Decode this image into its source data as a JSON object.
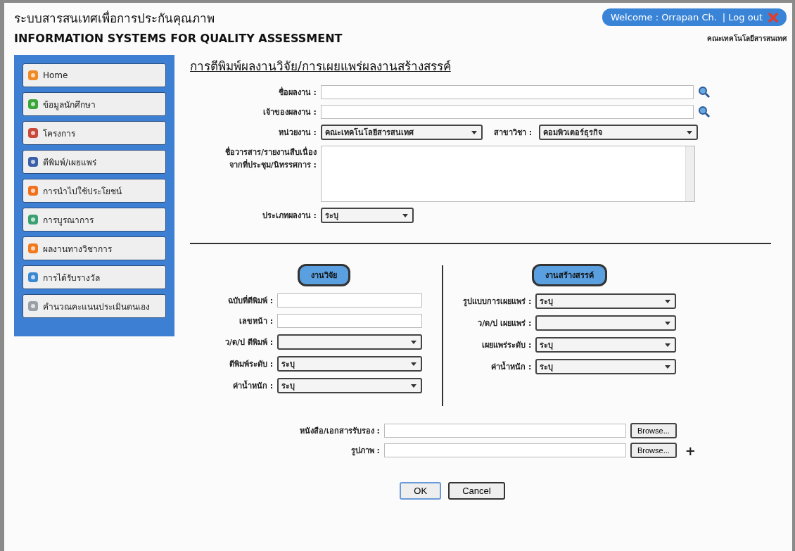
{
  "header": {
    "title_th": "ระบบสารสนเทศเพื่อการประกันคุณภาพ",
    "title_en": "INFORMATION SYSTEMS FOR QUALITY ASSESSMENT",
    "welcome": "Welcome : Orrapan Ch.",
    "logout": "| Log out",
    "faculty": "คณะเทคโนโลยีสารสนเทศ"
  },
  "sidebar": {
    "items": [
      {
        "label": "Home"
      },
      {
        "label": "ข้อมูลนักศึกษา"
      },
      {
        "label": "โครงการ"
      },
      {
        "label": "ตีพิมพ์/เผยแพร่"
      },
      {
        "label": "การนำไปใช้ประโยชน์"
      },
      {
        "label": "การบูรณาการ"
      },
      {
        "label": "ผลงานทางวิชาการ"
      },
      {
        "label": "การได้รับรางวัล"
      },
      {
        "label": "คำนวณคะแนนประเมินตนเอง"
      }
    ]
  },
  "form": {
    "title": "การตีพิมพ์ผลงานวิจัย/การเผยแพร่ผลงานสร้างสรรค์",
    "work_name": {
      "label": "ชื่อผลงาน :"
    },
    "owner": {
      "label": "เจ้าของผลงาน :"
    },
    "unit": {
      "label": "หน่วยงาน :",
      "value": "คณะเทคโนโลยีสารสนเทศ"
    },
    "major": {
      "label": "สาขาวิชา :",
      "value": "คอมพิวเตอร์ธุรกิจ"
    },
    "journal": {
      "label": "ชื่อวารสาร/รายงานสืบเนื่อง จากที่ประชุม/นิทรรศการ :"
    },
    "type": {
      "label": "ประเภทผลงาน :",
      "value": "ระบุ"
    }
  },
  "research": {
    "button": "งานวิจัย",
    "fields": [
      {
        "kind": "text",
        "label": "ฉบับที่ตีพิมพ์ :"
      },
      {
        "kind": "text",
        "label": "เลขหน้า :"
      },
      {
        "kind": "select",
        "label": "ว/ด/ป ตีพิมพ์ :"
      },
      {
        "kind": "select",
        "label": "ตีพิมพ์ระดับ :",
        "value": "ระบุ"
      },
      {
        "kind": "select",
        "label": "ค่าน้ำหนัก :",
        "value": "ระบุ"
      }
    ]
  },
  "creative": {
    "button": "งานสร้างสรรค์",
    "fields": [
      {
        "kind": "select",
        "label": "รูปแบบการเผยแพร่ :",
        "value": "ระบุ"
      },
      {
        "kind": "select",
        "label": "ว/ด/ป เผยแพร่ :"
      },
      {
        "kind": "select",
        "label": "เผยแพร่ระดับ :",
        "value": "ระบุ"
      },
      {
        "kind": "select",
        "label": "ค่าน้ำหนัก :",
        "value": "ระบุ"
      }
    ]
  },
  "files": [
    {
      "label": "หนังสือ/เอกสารรับรอง :",
      "button": "Browse..."
    },
    {
      "label": "รูปภาพ :",
      "button": "Browse...",
      "add": "+"
    }
  ],
  "buttons": {
    "ok": "OK",
    "cancel": "Cancel"
  }
}
